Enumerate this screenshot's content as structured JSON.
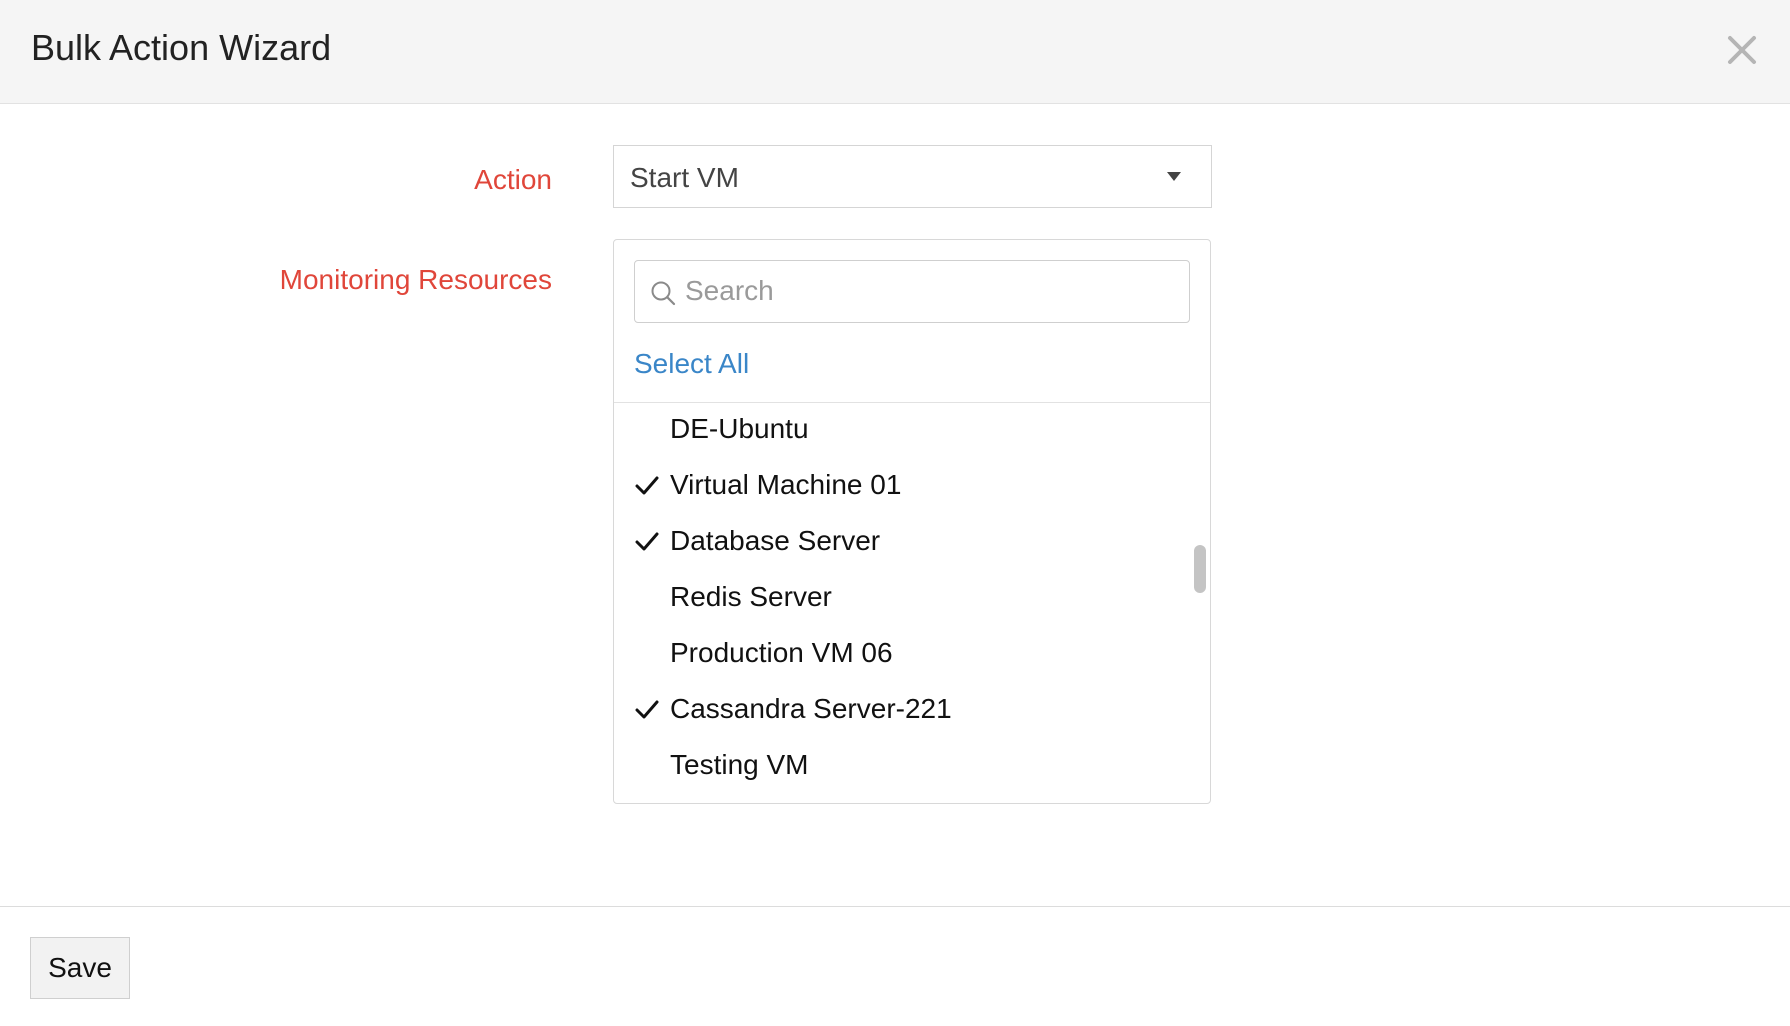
{
  "dialog": {
    "title": "Bulk Action Wizard",
    "close_icon": "close-icon"
  },
  "form": {
    "action_label": "Action",
    "action_value": "Start VM",
    "resources_label": "Monitoring Resources"
  },
  "resources": {
    "search_placeholder": "Search",
    "search_value": "",
    "select_all_label": "Select All",
    "items": [
      {
        "label": "DE-Ubuntu",
        "checked": false
      },
      {
        "label": "Virtual Machine 01",
        "checked": true
      },
      {
        "label": "Database Server",
        "checked": true
      },
      {
        "label": "Redis Server",
        "checked": false
      },
      {
        "label": "Production VM 06",
        "checked": false
      },
      {
        "label": "Cassandra Server-221",
        "checked": true
      },
      {
        "label": "Testing VM",
        "checked": false
      }
    ]
  },
  "footer": {
    "save_label": "Save"
  },
  "colors": {
    "label_red": "#e0463a",
    "link_blue": "#3a86c8",
    "header_bg": "#f5f5f5"
  }
}
